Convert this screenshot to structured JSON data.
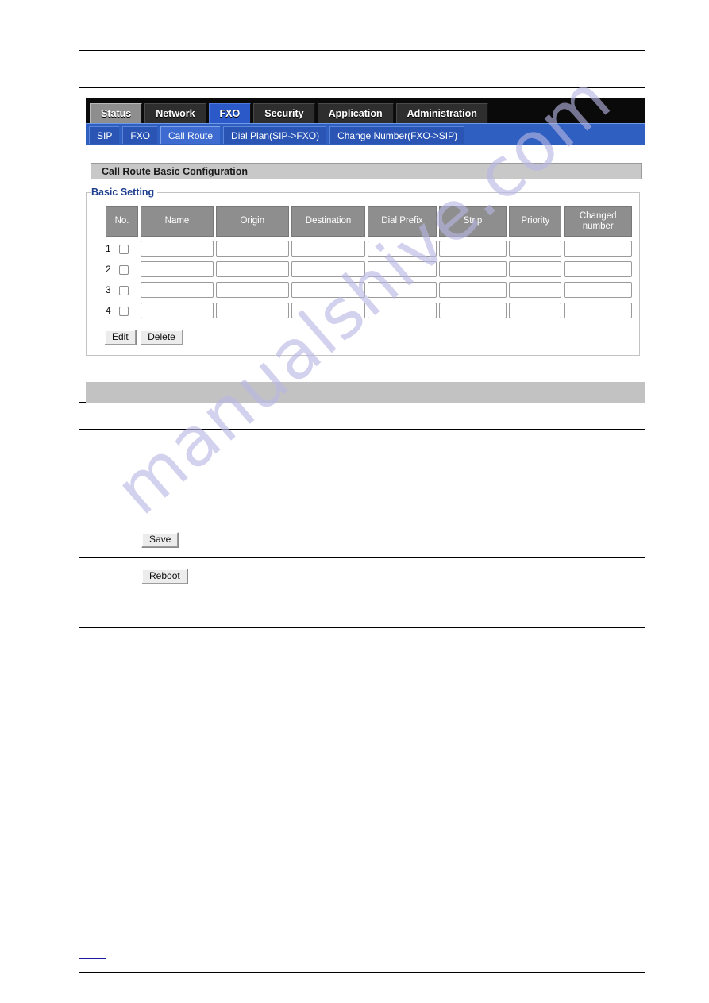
{
  "primary_tabs": [
    {
      "label": "Status",
      "state": "first"
    },
    {
      "label": "Network",
      "state": "normal"
    },
    {
      "label": "FXO",
      "state": "active"
    },
    {
      "label": "Security",
      "state": "normal"
    },
    {
      "label": "Application",
      "state": "normal"
    },
    {
      "label": "Administration",
      "state": "normal"
    }
  ],
  "sub_tabs": [
    {
      "label": "SIP",
      "state": "normal"
    },
    {
      "label": "FXO",
      "state": "normal"
    },
    {
      "label": "Call Route",
      "state": "active"
    },
    {
      "label": "Dial Plan(SIP->FXO)",
      "state": "normal"
    },
    {
      "label": "Change Number(FXO->SIP)",
      "state": "normal"
    }
  ],
  "panel": {
    "title": "Call Route Basic Configuration",
    "legend": "Basic Setting"
  },
  "table": {
    "headers": [
      "No.",
      "Name",
      "Origin",
      "Destination",
      "Dial Prefix",
      "Strip",
      "Priority",
      "Changed number"
    ],
    "rows": [
      {
        "no": "1",
        "checked": false,
        "name": "",
        "origin": "",
        "destination": "",
        "dial_prefix": "",
        "strip": "",
        "priority": "",
        "changed_number": ""
      },
      {
        "no": "2",
        "checked": false,
        "name": "",
        "origin": "",
        "destination": "",
        "dial_prefix": "",
        "strip": "",
        "priority": "",
        "changed_number": ""
      },
      {
        "no": "3",
        "checked": false,
        "name": "",
        "origin": "",
        "destination": "",
        "dial_prefix": "",
        "strip": "",
        "priority": "",
        "changed_number": ""
      },
      {
        "no": "4",
        "checked": false,
        "name": "",
        "origin": "",
        "destination": "",
        "dial_prefix": "",
        "strip": "",
        "priority": "",
        "changed_number": ""
      }
    ]
  },
  "panel_buttons": {
    "edit": "Edit",
    "delete": "Delete"
  },
  "document_buttons": {
    "save": "Save",
    "reboot": "Reboot"
  },
  "watermark": {
    "text": "manualshive.com"
  },
  "colors": {
    "tab_active": "#2b59c8",
    "subbar": "#2f5fc0",
    "tabbar": "#0a0a0a",
    "header_cell": "#8e8e8e",
    "panel_title": "#c8c8c8",
    "legend": "#1f3f8f",
    "watermark": "#b9b7e4"
  }
}
